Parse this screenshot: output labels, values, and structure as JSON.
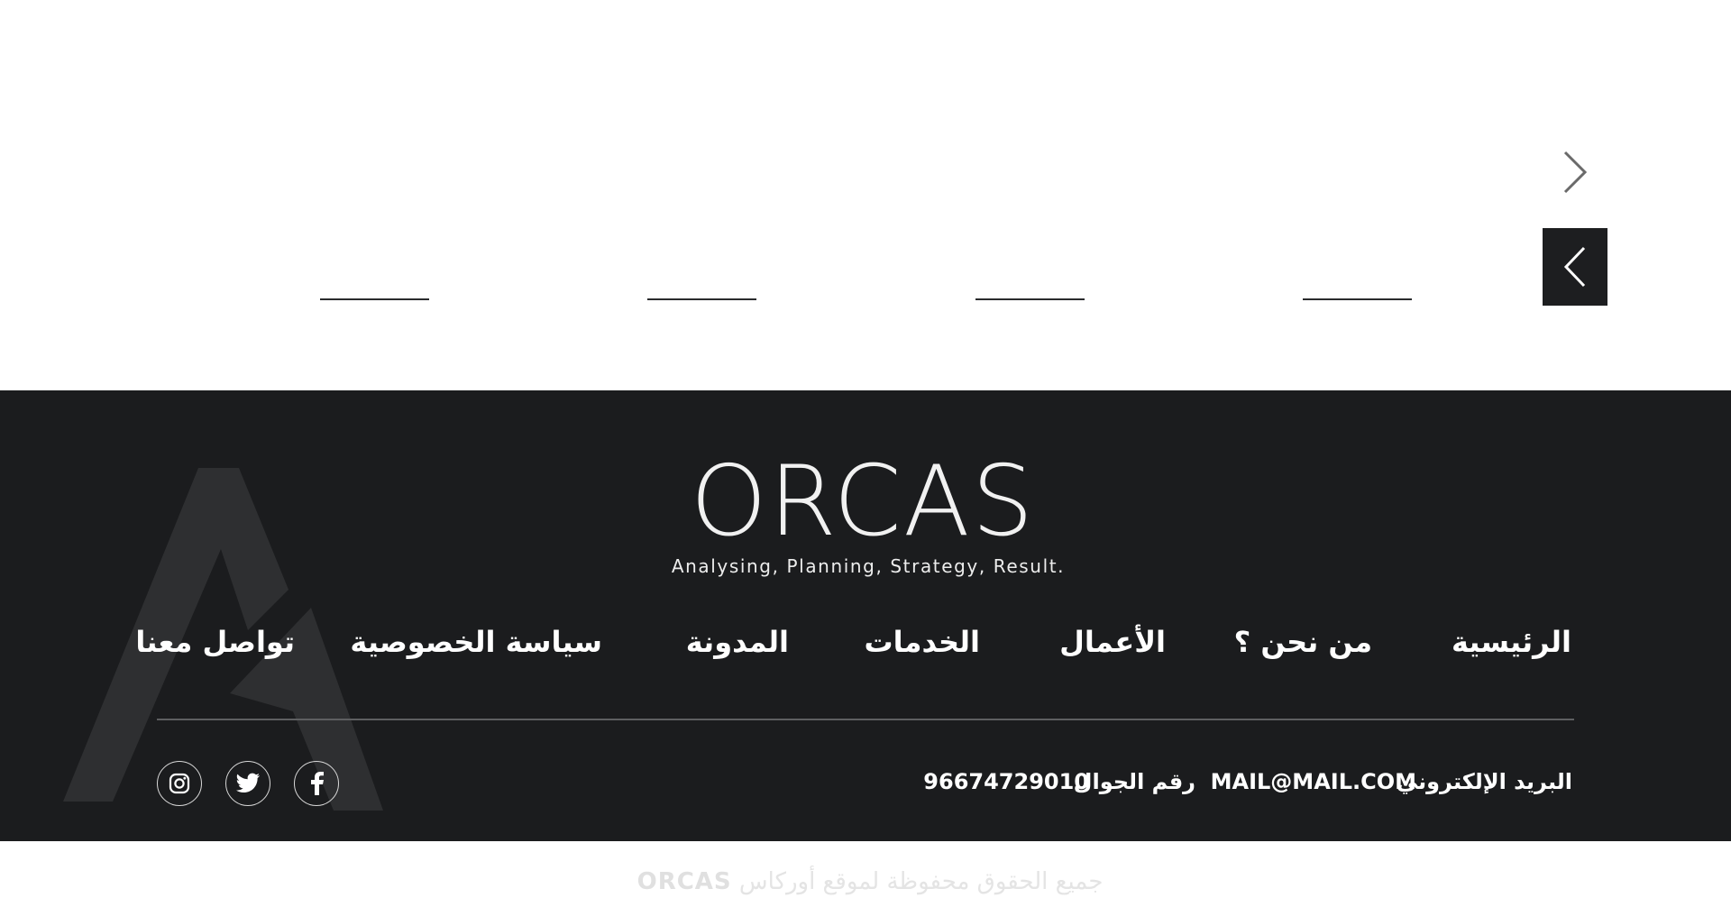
{
  "brand": {
    "logo_text": "ORCAS",
    "tagline": "Analysing, Planning, Strategy, Result."
  },
  "nav": {
    "home": "الرئيسية",
    "about": "من نحن ؟",
    "works": "الأعمال",
    "services": "الخدمات",
    "blog": "المدونة",
    "privacy": "سياسة الخصوصية",
    "contact": "تواصل معنا"
  },
  "contact": {
    "email_label": "البريد الإلكتروني",
    "email_value": "MAIL@MAIL.COM",
    "phone_label": "رقم الجوال",
    "phone_value": "96674729010"
  },
  "social": [
    "facebook-icon",
    "twitter-icon",
    "instagram-icon"
  ],
  "copyright": {
    "text": "جميع الحقوق محفوظة لموقع أوركاس",
    "logo_text": "ORCAS"
  },
  "colors": {
    "footer_bg": "#1b1c1e",
    "prev_button_bg": "#1d1e20",
    "text_light": "#ffffff"
  }
}
